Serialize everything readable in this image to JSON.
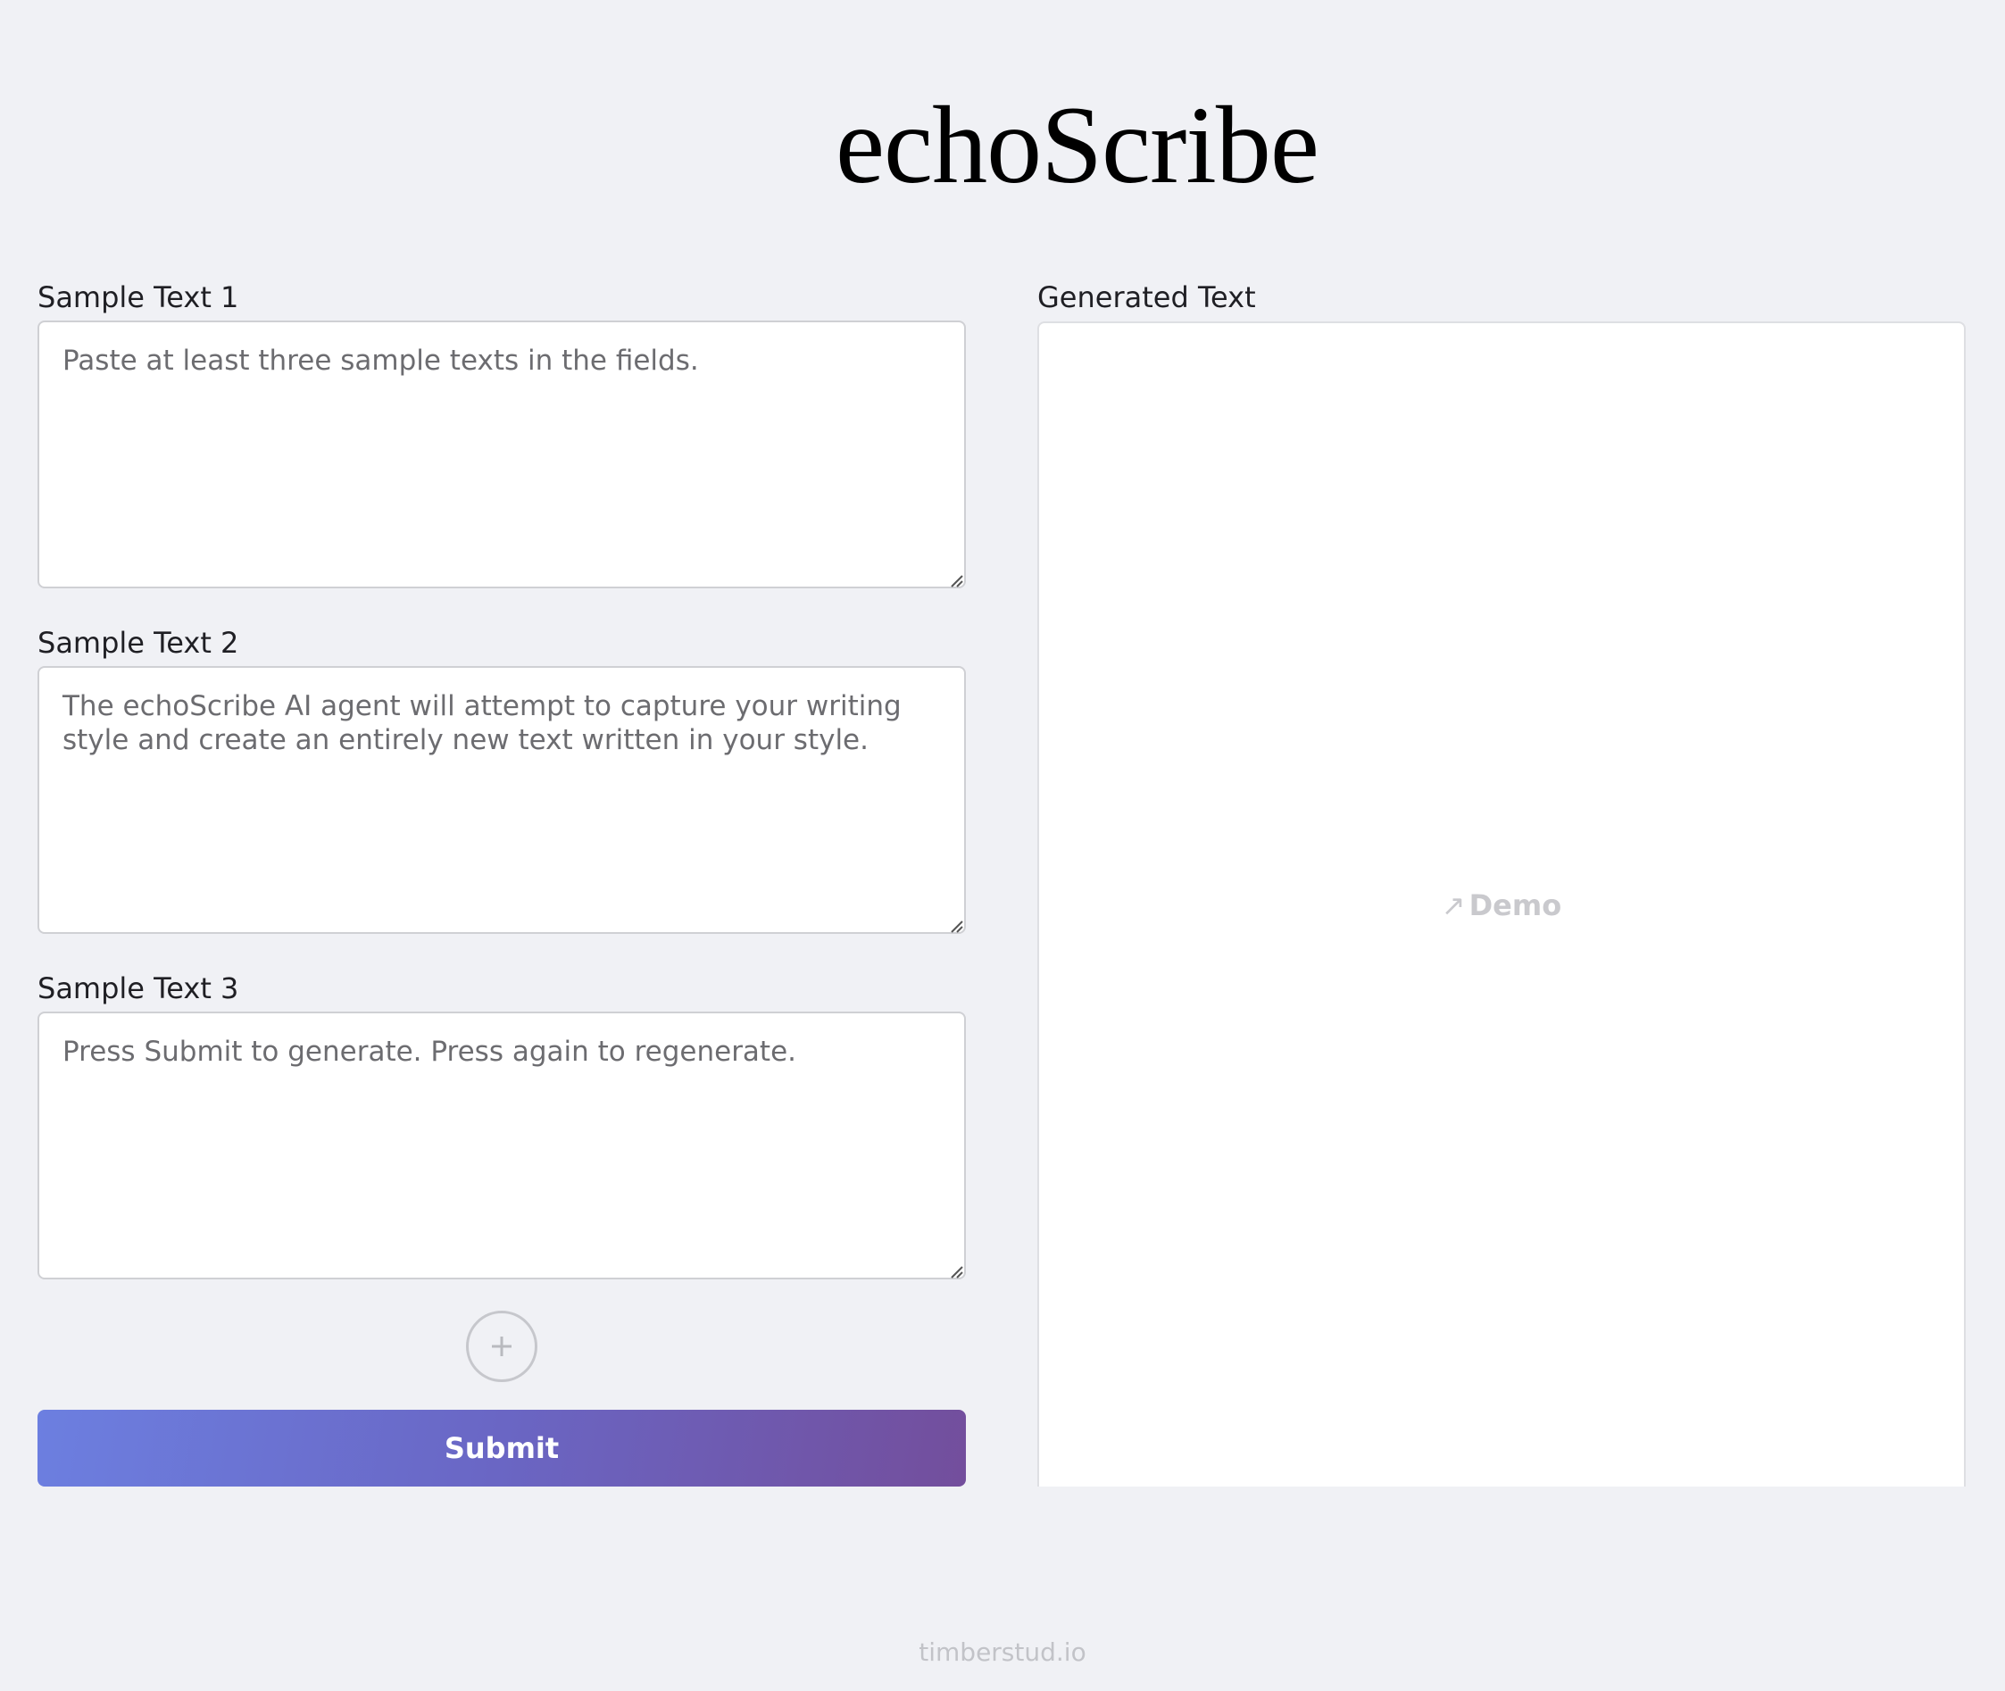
{
  "header": {
    "title": "echoScribe"
  },
  "samples": [
    {
      "label": "Sample Text 1",
      "placeholder": "Paste at least three sample texts in the fields.",
      "value": ""
    },
    {
      "label": "Sample Text 2",
      "placeholder": "The echoScribe AI agent will attempt to capture your writing style and create an entirely new text written in your style.",
      "value": ""
    },
    {
      "label": "Sample Text 3",
      "placeholder": "Press Submit to generate. Press again to regenerate.",
      "value": ""
    }
  ],
  "add_button": {
    "icon": "plus-icon"
  },
  "submit": {
    "label": "Submit"
  },
  "output": {
    "label": "Generated Text",
    "demo_link": "Demo",
    "demo_icon": "arrow-up-right-icon"
  },
  "footer": {
    "text": "timberstud.io"
  },
  "colors": {
    "accent": "#6a6fc8",
    "accent_dark": "#734e9c",
    "background": "#f0f1f5"
  }
}
